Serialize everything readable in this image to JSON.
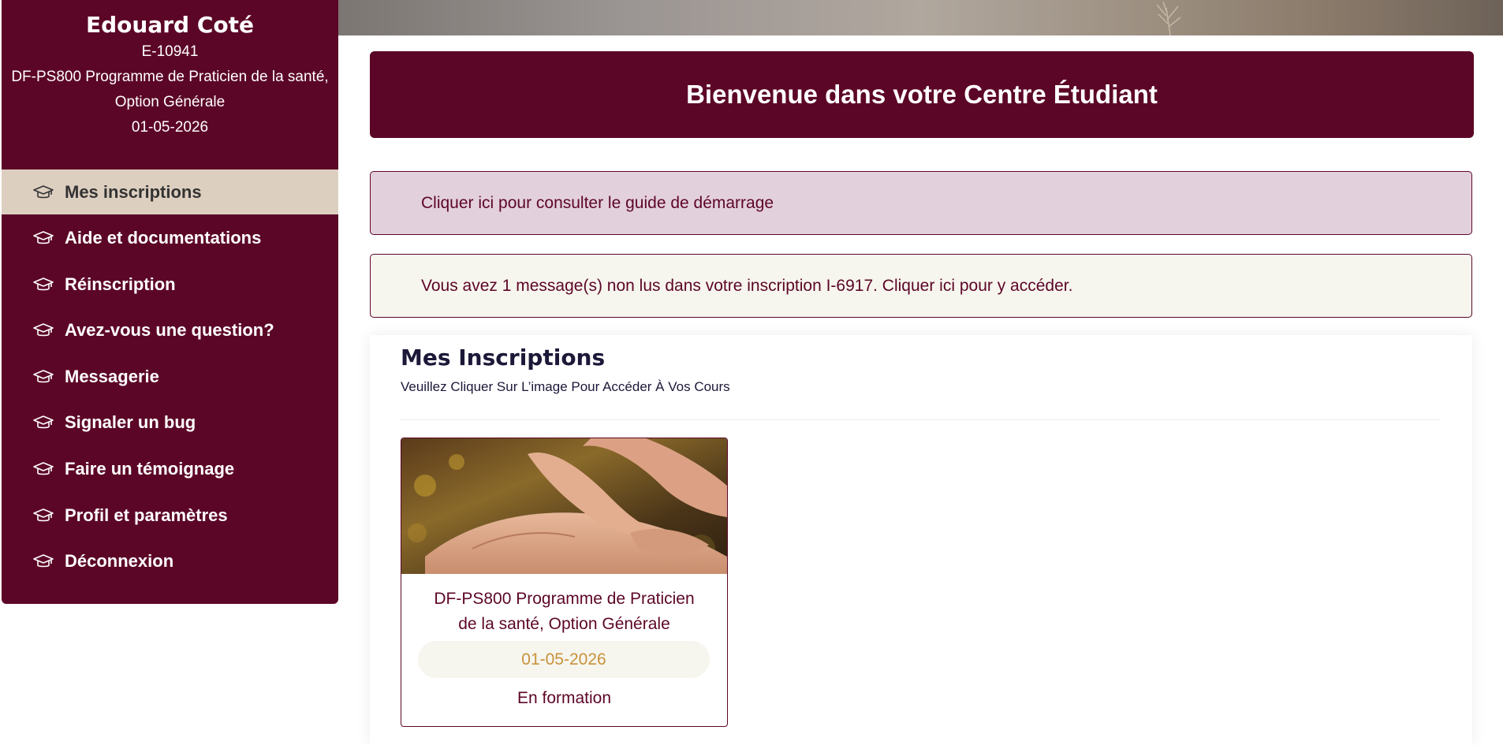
{
  "student": {
    "name": "Edouard Coté",
    "id": "E-10941",
    "program_line1": "DF-PS800 Programme de Praticien de la santé,",
    "program_line2": "Option Générale",
    "date": "01-05-2026"
  },
  "sidebar": {
    "items": [
      {
        "label": "Mes inscriptions",
        "icon": "graduation-cap-icon",
        "active": true
      },
      {
        "label": "Aide et documentations",
        "icon": "graduation-cap-icon"
      },
      {
        "label": "Réinscription",
        "icon": "graduation-cap-icon"
      },
      {
        "label": "Avez-vous une question?",
        "icon": "graduation-cap-icon"
      },
      {
        "label": "Messagerie",
        "icon": "graduation-cap-icon"
      },
      {
        "label": "Signaler un bug",
        "icon": "graduation-cap-icon"
      },
      {
        "label": "Faire un témoignage",
        "icon": "graduation-cap-icon"
      },
      {
        "label": "Profil et paramètres",
        "icon": "graduation-cap-icon"
      },
      {
        "label": "Déconnexion",
        "icon": "graduation-cap-icon"
      }
    ]
  },
  "header": {
    "welcome": "Bienvenue dans votre Centre Étudiant"
  },
  "alerts": {
    "guide": "Cliquer ici pour consulter le guide de démarrage",
    "messages": "Vous avez 1 message(s) non lus dans votre inscription I-6917. Cliquer ici pour y accéder."
  },
  "inscriptions": {
    "title": "Mes Inscriptions",
    "subtitle": "Veuillez Cliquer Sur L’image Pour Accéder À Vos Cours",
    "courses": [
      {
        "title_line1": "DF-PS800 Programme de Praticien",
        "title_line2": "de la santé, Option Générale",
        "date": "01-05-2026",
        "status": "En formation"
      }
    ]
  },
  "colors": {
    "brand": "#5c0627",
    "active_nav": "#ddcfc0",
    "guide_bg": "#e3d0dd",
    "message_bg": "#f6f5ee",
    "date_text": "#c8923a"
  }
}
